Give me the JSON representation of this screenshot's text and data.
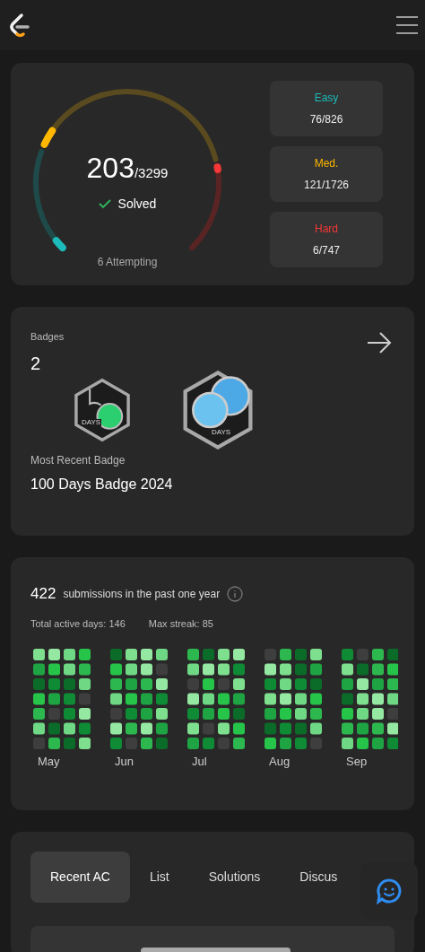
{
  "progress": {
    "solved": "203",
    "total": "/3299",
    "solved_label": "Solved",
    "attempting": "6 Attempting",
    "difficulties": [
      {
        "kind": "easy",
        "label": "Easy",
        "count": "76/826",
        "color": "#1cbaba"
      },
      {
        "kind": "medium",
        "label": "Med.",
        "count": "121/1726",
        "color": "#ffb700"
      },
      {
        "kind": "hard",
        "label": "Hard",
        "count": "6/747",
        "color": "#f63737"
      }
    ]
  },
  "badges": {
    "title": "Badges",
    "count": "2",
    "items": [
      {
        "kind": "fifty",
        "caption": "DAYS"
      },
      {
        "kind": "hundred",
        "caption": "DAYS"
      }
    ],
    "recent_label": "Most Recent Badge",
    "recent_name": "100 Days Badge 2024"
  },
  "submissions": {
    "count": "422",
    "text": "submissions in the past one year",
    "active_days": "Total active days: 146",
    "max_streak": "Max streak: 85",
    "months": [
      "May",
      "Jun",
      "Jul",
      "Aug",
      "Sep"
    ]
  },
  "tabs": [
    {
      "label": "Recent AC",
      "selected": true
    },
    {
      "label": "List",
      "selected": false
    },
    {
      "label": "Solutions",
      "selected": false
    },
    {
      "label": "Discus",
      "selected": false
    }
  ]
}
